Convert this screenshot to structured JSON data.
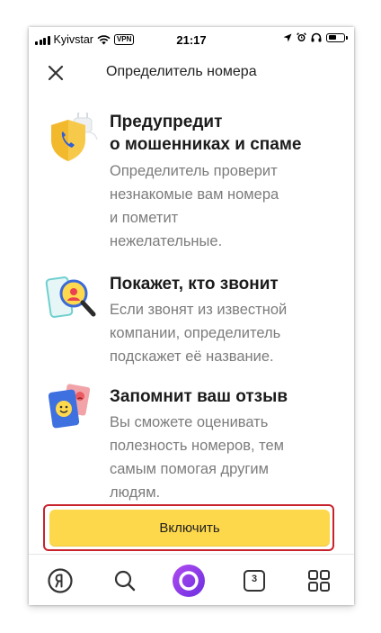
{
  "status_bar": {
    "carrier": "Kyivstar",
    "vpn_badge": "VPN",
    "time": "21:17",
    "battery_level_percent": 55
  },
  "header": {
    "title": "Определитель номера",
    "close_icon": "close-icon"
  },
  "features": [
    {
      "icon": "shield-phone-icon",
      "title_lines": [
        "Предупредит",
        "о мошенниках и спаме"
      ],
      "desc_lines": [
        "Определитель проверит",
        "незнакомые вам номера",
        "и пометит",
        "нежелательные."
      ]
    },
    {
      "icon": "caller-magnifier-icon",
      "title_lines": [
        "Покажет, кто звонит"
      ],
      "desc_lines": [
        "Если звонят из известной",
        "компании, определитель",
        "подскажет её название."
      ]
    },
    {
      "icon": "feedback-faces-icon",
      "title_lines": [
        "Запомнит ваш отзыв"
      ],
      "desc_lines": [
        "Вы сможете оценивать",
        "полезность номеров, тем",
        "самым помогая другим",
        "людям."
      ]
    }
  ],
  "enable_button": {
    "label": "Включить"
  },
  "tab_bar": {
    "tabs_badge": "3",
    "items": [
      "yandex-logo-icon",
      "search-icon",
      "alice-icon",
      "tabs-icon",
      "apps-grid-icon"
    ]
  },
  "colors": {
    "accent_yellow": "#fed84b",
    "highlight_red": "#c8232c",
    "alice_purple": "#8a2be2"
  }
}
